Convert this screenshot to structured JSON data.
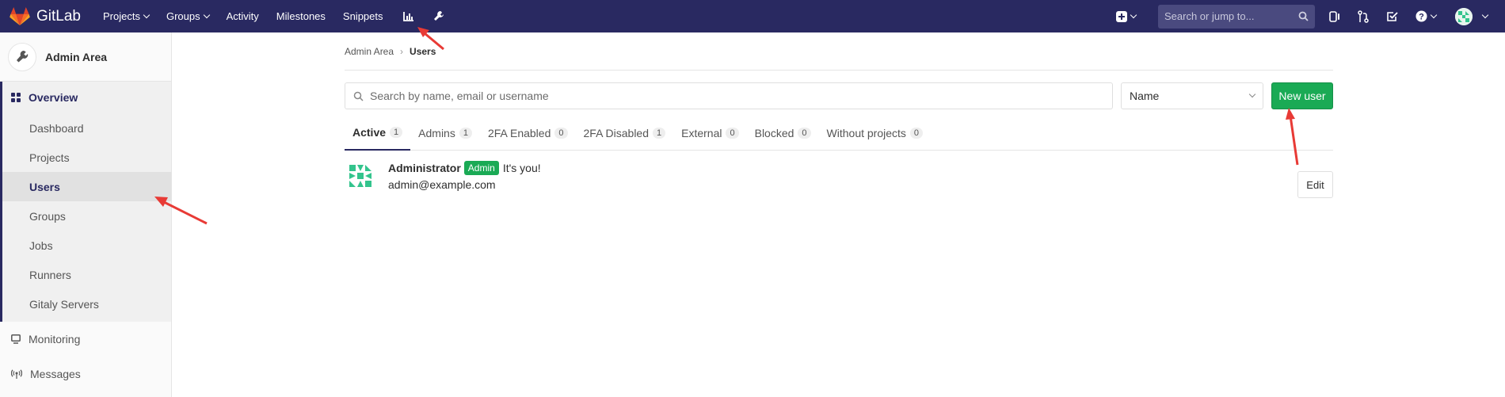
{
  "topbar": {
    "brand": "GitLab",
    "nav": [
      {
        "label": "Projects",
        "dropdown": true
      },
      {
        "label": "Groups",
        "dropdown": true
      },
      {
        "label": "Activity",
        "dropdown": false
      },
      {
        "label": "Milestones",
        "dropdown": false
      },
      {
        "label": "Snippets",
        "dropdown": false
      }
    ],
    "search_placeholder": "Search or jump to..."
  },
  "sidebar": {
    "title": "Admin Area",
    "overview_label": "Overview",
    "sub_items": [
      "Dashboard",
      "Projects",
      "Users",
      "Groups",
      "Jobs",
      "Runners",
      "Gitaly Servers"
    ],
    "active_item": "Users",
    "items": [
      "Monitoring",
      "Messages"
    ]
  },
  "breadcrumb": {
    "parent": "Admin Area",
    "current": "Users"
  },
  "filter": {
    "search_placeholder": "Search by name, email or username",
    "sort_value": "Name",
    "new_user_label": "New user"
  },
  "tabs": [
    {
      "label": "Active",
      "count": "1",
      "active": true
    },
    {
      "label": "Admins",
      "count": "1",
      "active": false
    },
    {
      "label": "2FA Enabled",
      "count": "0",
      "active": false
    },
    {
      "label": "2FA Disabled",
      "count": "1",
      "active": false
    },
    {
      "label": "External",
      "count": "0",
      "active": false
    },
    {
      "label": "Blocked",
      "count": "0",
      "active": false
    },
    {
      "label": "Without projects",
      "count": "0",
      "active": false
    }
  ],
  "user": {
    "name": "Administrator",
    "badge": "Admin",
    "note": "It's you!",
    "email": "admin@example.com",
    "edit_label": "Edit"
  },
  "colors": {
    "navbar": "#292961",
    "accent_green": "#1aaa55",
    "annotation_red": "#e83a35"
  }
}
